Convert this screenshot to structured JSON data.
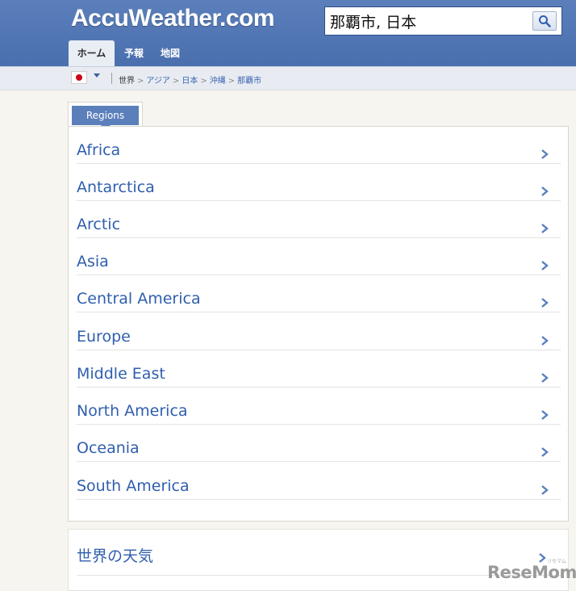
{
  "header": {
    "logo": "AccuWeather.com",
    "search": {
      "value": "那覇市, 日本"
    },
    "nav": [
      {
        "label": "ホーム",
        "active": true
      },
      {
        "label": "予報",
        "active": false
      },
      {
        "label": "地図",
        "active": false
      }
    ]
  },
  "breadcrumb": {
    "items": [
      "世界",
      "アジア",
      "日本",
      "沖縄",
      "那覇市"
    ],
    "separator": ">"
  },
  "regions": {
    "tab_label": "Regions",
    "items": [
      {
        "label": "Africa"
      },
      {
        "label": "Antarctica"
      },
      {
        "label": "Arctic"
      },
      {
        "label": "Asia"
      },
      {
        "label": "Central America"
      },
      {
        "label": "Europe"
      },
      {
        "label": "Middle East"
      },
      {
        "label": "North America"
      },
      {
        "label": "Oceania"
      },
      {
        "label": "South America"
      }
    ]
  },
  "world_weather": {
    "label": "世界の天気"
  },
  "watermark": {
    "text": "ReseMom",
    "sub": "リセマム"
  },
  "colors": {
    "header": "#5b7fbb",
    "link": "#2f5eae",
    "page_bg": "#f7f5f0"
  }
}
